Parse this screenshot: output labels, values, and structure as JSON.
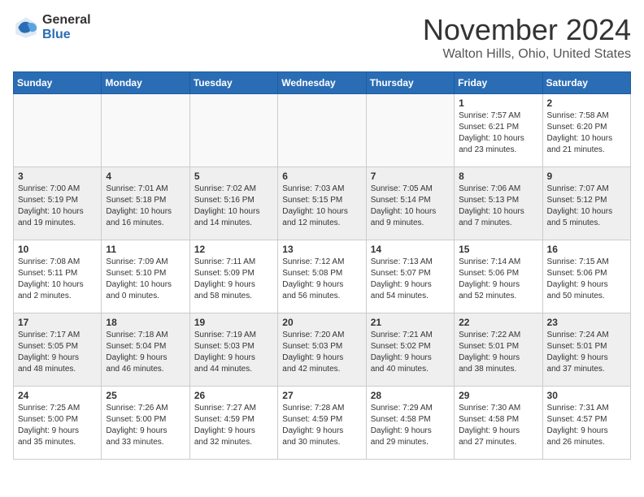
{
  "header": {
    "logo_general": "General",
    "logo_blue": "Blue",
    "month_title": "November 2024",
    "location": "Walton Hills, Ohio, United States"
  },
  "days_of_week": [
    "Sunday",
    "Monday",
    "Tuesday",
    "Wednesday",
    "Thursday",
    "Friday",
    "Saturday"
  ],
  "weeks": [
    [
      {
        "day": "",
        "info": ""
      },
      {
        "day": "",
        "info": ""
      },
      {
        "day": "",
        "info": ""
      },
      {
        "day": "",
        "info": ""
      },
      {
        "day": "",
        "info": ""
      },
      {
        "day": "1",
        "info": "Sunrise: 7:57 AM\nSunset: 6:21 PM\nDaylight: 10 hours\nand 23 minutes."
      },
      {
        "day": "2",
        "info": "Sunrise: 7:58 AM\nSunset: 6:20 PM\nDaylight: 10 hours\nand 21 minutes."
      }
    ],
    [
      {
        "day": "3",
        "info": "Sunrise: 7:00 AM\nSunset: 5:19 PM\nDaylight: 10 hours\nand 19 minutes."
      },
      {
        "day": "4",
        "info": "Sunrise: 7:01 AM\nSunset: 5:18 PM\nDaylight: 10 hours\nand 16 minutes."
      },
      {
        "day": "5",
        "info": "Sunrise: 7:02 AM\nSunset: 5:16 PM\nDaylight: 10 hours\nand 14 minutes."
      },
      {
        "day": "6",
        "info": "Sunrise: 7:03 AM\nSunset: 5:15 PM\nDaylight: 10 hours\nand 12 minutes."
      },
      {
        "day": "7",
        "info": "Sunrise: 7:05 AM\nSunset: 5:14 PM\nDaylight: 10 hours\nand 9 minutes."
      },
      {
        "day": "8",
        "info": "Sunrise: 7:06 AM\nSunset: 5:13 PM\nDaylight: 10 hours\nand 7 minutes."
      },
      {
        "day": "9",
        "info": "Sunrise: 7:07 AM\nSunset: 5:12 PM\nDaylight: 10 hours\nand 5 minutes."
      }
    ],
    [
      {
        "day": "10",
        "info": "Sunrise: 7:08 AM\nSunset: 5:11 PM\nDaylight: 10 hours\nand 2 minutes."
      },
      {
        "day": "11",
        "info": "Sunrise: 7:09 AM\nSunset: 5:10 PM\nDaylight: 10 hours\nand 0 minutes."
      },
      {
        "day": "12",
        "info": "Sunrise: 7:11 AM\nSunset: 5:09 PM\nDaylight: 9 hours\nand 58 minutes."
      },
      {
        "day": "13",
        "info": "Sunrise: 7:12 AM\nSunset: 5:08 PM\nDaylight: 9 hours\nand 56 minutes."
      },
      {
        "day": "14",
        "info": "Sunrise: 7:13 AM\nSunset: 5:07 PM\nDaylight: 9 hours\nand 54 minutes."
      },
      {
        "day": "15",
        "info": "Sunrise: 7:14 AM\nSunset: 5:06 PM\nDaylight: 9 hours\nand 52 minutes."
      },
      {
        "day": "16",
        "info": "Sunrise: 7:15 AM\nSunset: 5:06 PM\nDaylight: 9 hours\nand 50 minutes."
      }
    ],
    [
      {
        "day": "17",
        "info": "Sunrise: 7:17 AM\nSunset: 5:05 PM\nDaylight: 9 hours\nand 48 minutes."
      },
      {
        "day": "18",
        "info": "Sunrise: 7:18 AM\nSunset: 5:04 PM\nDaylight: 9 hours\nand 46 minutes."
      },
      {
        "day": "19",
        "info": "Sunrise: 7:19 AM\nSunset: 5:03 PM\nDaylight: 9 hours\nand 44 minutes."
      },
      {
        "day": "20",
        "info": "Sunrise: 7:20 AM\nSunset: 5:03 PM\nDaylight: 9 hours\nand 42 minutes."
      },
      {
        "day": "21",
        "info": "Sunrise: 7:21 AM\nSunset: 5:02 PM\nDaylight: 9 hours\nand 40 minutes."
      },
      {
        "day": "22",
        "info": "Sunrise: 7:22 AM\nSunset: 5:01 PM\nDaylight: 9 hours\nand 38 minutes."
      },
      {
        "day": "23",
        "info": "Sunrise: 7:24 AM\nSunset: 5:01 PM\nDaylight: 9 hours\nand 37 minutes."
      }
    ],
    [
      {
        "day": "24",
        "info": "Sunrise: 7:25 AM\nSunset: 5:00 PM\nDaylight: 9 hours\nand 35 minutes."
      },
      {
        "day": "25",
        "info": "Sunrise: 7:26 AM\nSunset: 5:00 PM\nDaylight: 9 hours\nand 33 minutes."
      },
      {
        "day": "26",
        "info": "Sunrise: 7:27 AM\nSunset: 4:59 PM\nDaylight: 9 hours\nand 32 minutes."
      },
      {
        "day": "27",
        "info": "Sunrise: 7:28 AM\nSunset: 4:59 PM\nDaylight: 9 hours\nand 30 minutes."
      },
      {
        "day": "28",
        "info": "Sunrise: 7:29 AM\nSunset: 4:58 PM\nDaylight: 9 hours\nand 29 minutes."
      },
      {
        "day": "29",
        "info": "Sunrise: 7:30 AM\nSunset: 4:58 PM\nDaylight: 9 hours\nand 27 minutes."
      },
      {
        "day": "30",
        "info": "Sunrise: 7:31 AM\nSunset: 4:57 PM\nDaylight: 9 hours\nand 26 minutes."
      }
    ]
  ]
}
